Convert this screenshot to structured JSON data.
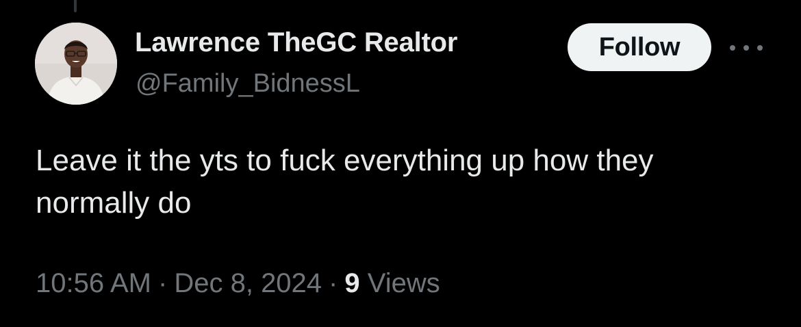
{
  "tweet": {
    "author": {
      "display_name": "Lawrence TheGC Realtor",
      "handle": "@Family_BidnessL"
    },
    "follow_label": "Follow",
    "more_icon": "more-horizontal-icon",
    "text": "Leave it the yts to fuck everything up how they normally do",
    "meta": {
      "time": "10:56 AM",
      "separator": "·",
      "date": "Dec 8, 2024",
      "views_count": "9",
      "views_label": "Views"
    }
  },
  "colors": {
    "background": "#000000",
    "primary_text": "#e7e9ea",
    "secondary_text": "#71767b",
    "follow_bg": "#eff3f4",
    "follow_text": "#0f1419",
    "thread_line": "#333639"
  }
}
